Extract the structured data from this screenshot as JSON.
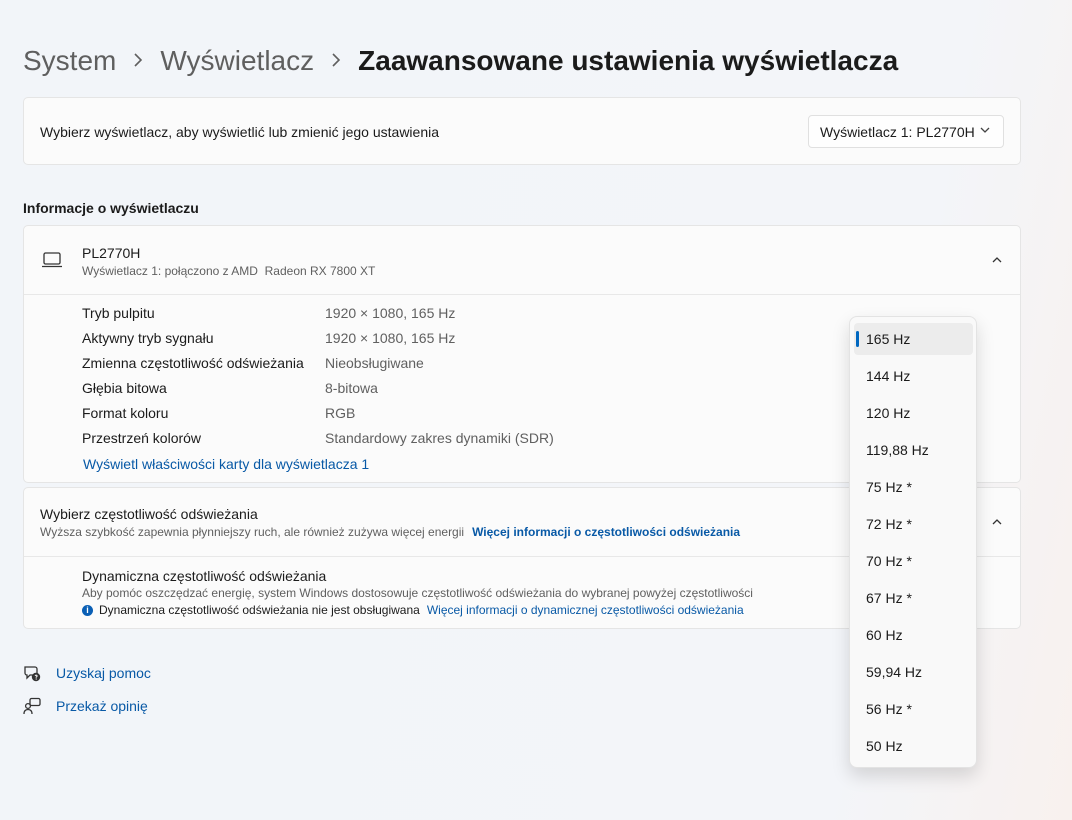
{
  "breadcrumb": {
    "items": [
      "System",
      "Wyświetlacz",
      "Zaawansowane ustawienia wyświetlacza"
    ]
  },
  "display_select": {
    "label": "Wybierz wyświetlacz, aby wyświetlić lub zmienić jego ustawienia",
    "value": "Wyświetlacz 1: PL2770H"
  },
  "info_section": {
    "title": "Informacje o wyświetlaczu",
    "name": "PL2770H",
    "subtitle": "Wyświetlacz 1: połączono z AMD  Radeon RX 7800 XT",
    "props": [
      {
        "key": "Tryb pulpitu",
        "value": "1920 × 1080, 165 Hz"
      },
      {
        "key": "Aktywny tryb sygnału",
        "value": "1920 × 1080, 165 Hz"
      },
      {
        "key": "Zmienna częstotliwość odświeżania",
        "value": "Nieobsługiwane"
      },
      {
        "key": "Głębia bitowa",
        "value": "8-bitowa"
      },
      {
        "key": "Format koloru",
        "value": "RGB"
      },
      {
        "key": "Przestrzeń kolorów",
        "value": "Standardowy zakres dynamiki (SDR)"
      }
    ],
    "adapter_link": "Wyświetl właściwości karty dla wyświetlacza 1"
  },
  "refresh": {
    "title": "Wybierz częstotliwość odświeżania",
    "subtitle": "Wyższa szybkość zapewnia płynniejszy ruch, ale również zużywa więcej energii",
    "more_link": "Więcej informacji o częstotliwości odświeżania",
    "dynamic_title": "Dynamiczna częstotliwość odświeżania",
    "dynamic_sub": "Aby pomóc oszczędzać energię, system Windows dostosowuje częstotliwość odświeżania do wybranej powyżej częstotliwości",
    "dynamic_info": "Dynamiczna częstotliwość odświeżania nie jest obsługiwana",
    "dynamic_link": "Więcej informacji o dynamicznej częstotliwości odświeżania",
    "info_glyph": "i"
  },
  "help_links": {
    "help": "Uzyskaj pomoc",
    "feedback": "Przekaż opinię"
  },
  "refresh_options": {
    "selected": "165 Hz",
    "items": [
      "165 Hz",
      "144 Hz",
      "120 Hz",
      "119,88 Hz",
      "75 Hz *",
      "72 Hz *",
      "70 Hz *",
      "67 Hz *",
      "60 Hz",
      "59,94 Hz",
      "56 Hz *",
      "50 Hz"
    ]
  },
  "colors": {
    "accent": "#0067c0",
    "link": "#0859a6"
  },
  "icons": [
    "chevron-right-icon",
    "chevron-down-icon",
    "chevron-up-icon",
    "monitor-icon",
    "info-icon",
    "help-icon",
    "feedback-icon"
  ]
}
